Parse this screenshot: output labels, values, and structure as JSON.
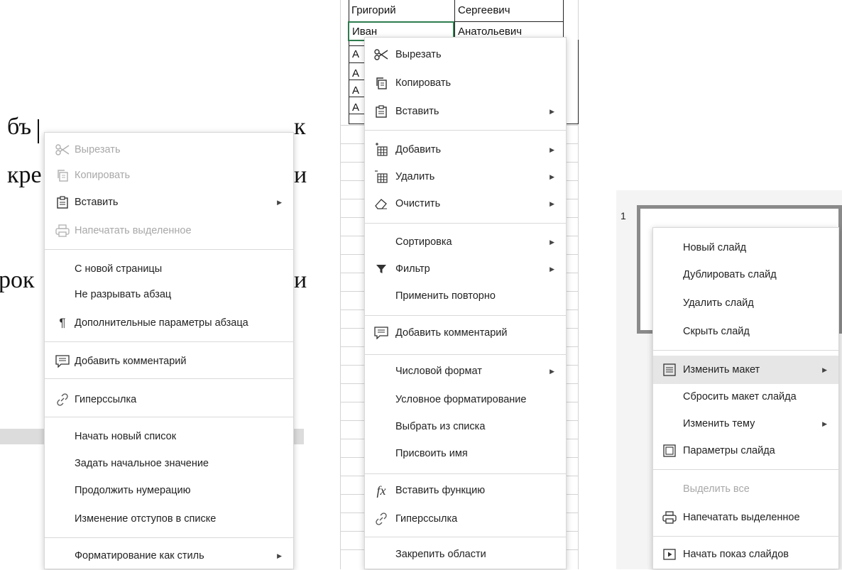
{
  "document": {
    "lines": [
      "бъ",
      "кре",
      "рок"
    ],
    "tail_chars": [
      "к",
      "и",
      "и"
    ]
  },
  "doc_menu": {
    "items": [
      {
        "label": "Вырезать",
        "icon": "scissors-icon",
        "disabled": true
      },
      {
        "label": "Копировать",
        "icon": "copy-icon",
        "disabled": true
      },
      {
        "label": "Вставить",
        "icon": "paste-icon",
        "submenu": true
      },
      {
        "label": "Напечатать выделенное",
        "icon": "printer-icon",
        "disabled": true
      },
      {
        "label": "С новой страницы"
      },
      {
        "label": "Не разрывать абзац"
      },
      {
        "label": "Дополнительные параметры абзаца",
        "icon": "paragraph-icon"
      },
      {
        "label": "Добавить комментарий",
        "icon": "comment-icon"
      },
      {
        "label": "Гиперссылка",
        "icon": "link-icon"
      },
      {
        "label": "Начать новый список"
      },
      {
        "label": "Задать начальное значение"
      },
      {
        "label": "Продолжить нумерацию"
      },
      {
        "label": "Изменение отступов в списке"
      },
      {
        "label": "Форматирование как стиль",
        "submenu": true
      }
    ]
  },
  "sheet": {
    "cells": [
      {
        "col1": "Григорий",
        "col2": "Сергеевич"
      },
      {
        "col1": "Иван",
        "col2": "Анатольевич"
      },
      {
        "col1": "А",
        "col2": ""
      },
      {
        "col1": "А",
        "col2": ""
      },
      {
        "col1": "А",
        "col2": ""
      },
      {
        "col1": "А",
        "col2": ""
      }
    ]
  },
  "sheet_menu": {
    "items": [
      {
        "label": "Вырезать",
        "icon": "scissors-icon"
      },
      {
        "label": "Копировать",
        "icon": "copy-icon"
      },
      {
        "label": "Вставить",
        "icon": "paste-icon",
        "submenu": true
      },
      {
        "label": "Добавить",
        "icon": "insert-cells-icon",
        "submenu": true
      },
      {
        "label": "Удалить",
        "icon": "delete-cells-icon",
        "submenu": true
      },
      {
        "label": "Очистить",
        "icon": "eraser-icon",
        "submenu": true
      },
      {
        "label": "Сортировка",
        "submenu": true
      },
      {
        "label": "Фильтр",
        "icon": "filter-icon",
        "submenu": true
      },
      {
        "label": "Применить повторно"
      },
      {
        "label": "Добавить комментарий",
        "icon": "comment-icon"
      },
      {
        "label": "Числовой формат",
        "submenu": true
      },
      {
        "label": "Условное форматирование"
      },
      {
        "label": "Выбрать из списка"
      },
      {
        "label": "Присвоить имя"
      },
      {
        "label": "Вставить функцию",
        "icon": "function-icon"
      },
      {
        "label": "Гиперссылка",
        "icon": "link-icon"
      },
      {
        "label": "Закрепить области"
      }
    ]
  },
  "slides": {
    "slide_number": "1"
  },
  "slide_menu": {
    "items": [
      {
        "label": "Новый слайд"
      },
      {
        "label": "Дублировать слайд"
      },
      {
        "label": "Удалить слайд"
      },
      {
        "label": "Скрыть слайд"
      },
      {
        "label": "Изменить макет",
        "icon": "layout-icon",
        "submenu": true,
        "highlighted": true
      },
      {
        "label": "Сбросить макет слайда"
      },
      {
        "label": "Изменить тему",
        "submenu": true
      },
      {
        "label": "Параметры слайда",
        "icon": "slide-settings-icon"
      },
      {
        "label": "Выделить все",
        "disabled": true
      },
      {
        "label": "Напечатать выделенное",
        "icon": "printer-icon"
      },
      {
        "label": "Начать показ слайдов",
        "icon": "play-slideshow-icon"
      }
    ]
  },
  "colors": {
    "menu_bg": "#ffffff",
    "disabled_text": "#a8a8a8",
    "highlight": "#e6e6e6",
    "active_cell_border": "#2e7d4f"
  }
}
